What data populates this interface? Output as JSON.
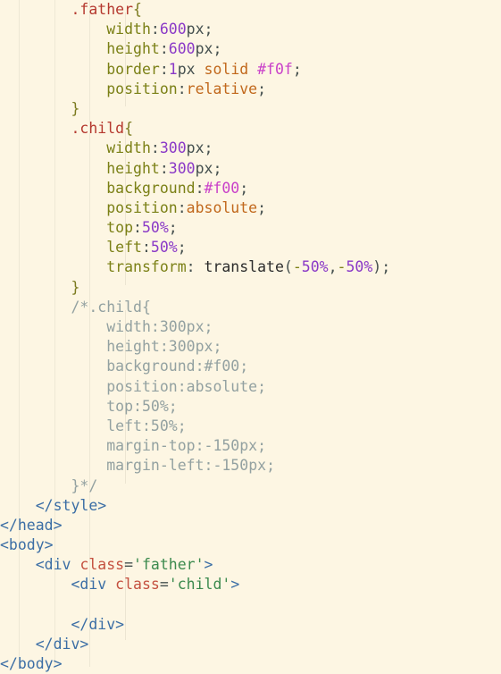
{
  "editor": {
    "name": "code-editor",
    "language": "html",
    "theme": "solarized-light",
    "background": "#fdf6e3",
    "font_size_px": 16.5,
    "line_height_px": 22.2,
    "indent_guides": true
  },
  "colors": {
    "background": "#fdf6e3",
    "default_text": "#3b4b52",
    "selector": "#b5392f",
    "property": "#7b8016",
    "number": "#8a39c7",
    "keyword": "#c1681c",
    "hex_color": "#c940c9",
    "comment": "#93a1a1",
    "tag_bracket": "#3b6ea5",
    "tag_name": "#5b7a99",
    "attribute_name": "#c4503f",
    "attribute_value": "#3c8a4e",
    "indent_guide": "#eee8d5"
  },
  "code": {
    "lines": [
      {
        "indent": 2,
        "text": ".father{"
      },
      {
        "indent": 3,
        "text": "width:600px;"
      },
      {
        "indent": 3,
        "text": "height:600px;"
      },
      {
        "indent": 3,
        "text": "border:1px solid #f0f;"
      },
      {
        "indent": 3,
        "text": "position:relative;"
      },
      {
        "indent": 2,
        "text": "}"
      },
      {
        "indent": 2,
        "text": ".child{"
      },
      {
        "indent": 3,
        "text": "width:300px;"
      },
      {
        "indent": 3,
        "text": "height:300px;"
      },
      {
        "indent": 3,
        "text": "background:#f00;"
      },
      {
        "indent": 3,
        "text": "position:absolute;"
      },
      {
        "indent": 3,
        "text": "top:50%;"
      },
      {
        "indent": 3,
        "text": "left:50%;"
      },
      {
        "indent": 3,
        "text": "transform: translate(-50%,-50%);"
      },
      {
        "indent": 2,
        "text": "}"
      },
      {
        "indent": 2,
        "text": "/*.child{"
      },
      {
        "indent": 3,
        "text": "width:300px;"
      },
      {
        "indent": 3,
        "text": "height:300px;"
      },
      {
        "indent": 3,
        "text": "background:#f00;"
      },
      {
        "indent": 3,
        "text": "position:absolute;"
      },
      {
        "indent": 3,
        "text": "top:50%;"
      },
      {
        "indent": 3,
        "text": "left:50%;"
      },
      {
        "indent": 3,
        "text": "margin-top:-150px;"
      },
      {
        "indent": 3,
        "text": "margin-left:-150px;"
      },
      {
        "indent": 2,
        "text": "}*/"
      },
      {
        "indent": 1,
        "text": "</style>"
      },
      {
        "indent": 0,
        "text": "</head>"
      },
      {
        "indent": 0,
        "text": "<body>"
      },
      {
        "indent": 1,
        "text": "<div class='father'>"
      },
      {
        "indent": 2,
        "text": "<div class='child'>"
      },
      {
        "indent": 0,
        "text": ""
      },
      {
        "indent": 2,
        "text": "</div>"
      },
      {
        "indent": 1,
        "text": "</div>"
      },
      {
        "indent": 0,
        "text": "</body>"
      }
    ],
    "tokens": {
      "sel_father": ".father",
      "sel_child": ".child",
      "brace_open": "{",
      "brace_close": "}",
      "prop_width": "width",
      "prop_height": "height",
      "prop_border": "border",
      "prop_position": "position",
      "prop_background": "background",
      "prop_top": "top",
      "prop_left": "left",
      "prop_transform": "transform",
      "prop_margin_top": "margin-top",
      "prop_margin_left": "margin-left",
      "val_600": "600",
      "val_300": "300",
      "val_1": "1",
      "val_50": "50",
      "val_150": "150",
      "unit_px": "px",
      "unit_pct": "%",
      "kw_relative": "relative",
      "kw_absolute": "absolute",
      "kw_solid": "solid",
      "hex_f0f": "#f0f",
      "hex_f00": "#f00",
      "fn_translate": "translate",
      "colon": ":",
      "semi": ";",
      "comma": ",",
      "minus": "-",
      "paren_open": "(",
      "paren_close": ")",
      "cmt_open": "/*",
      "cmt_close": "*/",
      "tag_style_close": "</style>",
      "tag_head_close": "</head>",
      "tag_body_open": "<body>",
      "tag_body_close": "</body>",
      "tag_div_close": "</div>",
      "tag_div_open": "<div",
      "attr_class": "class",
      "attr_eq": "=",
      "aval_father": "'father'",
      "aval_child": "'child'",
      "gt": ">"
    }
  }
}
